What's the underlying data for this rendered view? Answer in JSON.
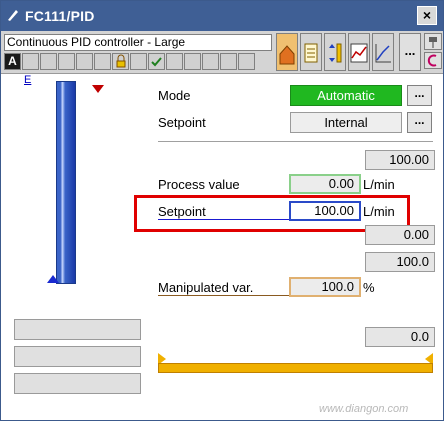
{
  "window": {
    "title": "FC111/PID",
    "close_label": "×"
  },
  "toolbar": {
    "block_name": "Continuous PID controller - Large",
    "mode_letter": "A",
    "more_label": "..."
  },
  "faceplate": {
    "e_label": "E",
    "mode": {
      "label": "Mode",
      "value": "Automatic",
      "more": "..."
    },
    "setpoint_source": {
      "label": "Setpoint",
      "value": "Internal",
      "more": "..."
    },
    "scale_high": "100.00",
    "process_value": {
      "label": "Process value",
      "value": "0.00",
      "unit": "L/min"
    },
    "setpoint": {
      "label": "Setpoint",
      "value": "100.00",
      "unit": "L/min"
    },
    "low_limit": "0.00",
    "output_high": "100.0",
    "manipulated": {
      "label": "Manipulated var.",
      "value": "100.0",
      "unit": "%"
    },
    "output_low": "0.0"
  },
  "watermark": "www.diangon.com",
  "colors": {
    "title_bar": "#3f5f95",
    "auto_green": "#20b820",
    "highlight": "#e00000",
    "slider": "#f0b000",
    "bar_blue": "#3a64c8"
  }
}
